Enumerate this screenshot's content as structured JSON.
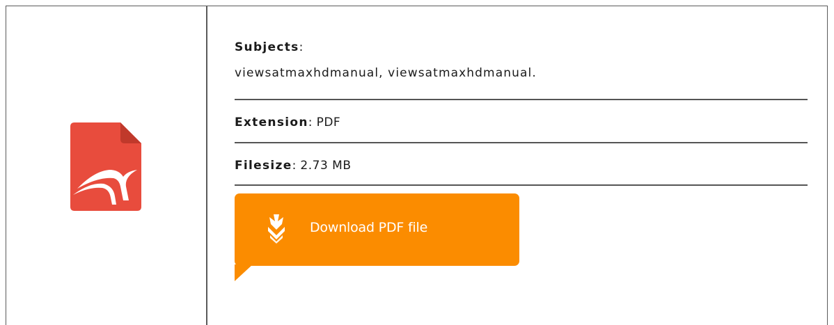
{
  "file_icon": {
    "icon": "pdf-file-icon",
    "color": "#e84c3d"
  },
  "details": {
    "subjects": {
      "label": "Subjects",
      "separator": ":",
      "value": "viewsatmaxhdmanual, viewsatmaxhdmanual."
    },
    "extension": {
      "label": "Extension",
      "separator": ":",
      "value": "PDF"
    },
    "filesize": {
      "label": "Filesize",
      "separator": ":",
      "value": "2.73 MB"
    }
  },
  "download_button": {
    "label": "Download PDF file",
    "icon": "download-arrow-icon",
    "color": "#fb8c00"
  }
}
